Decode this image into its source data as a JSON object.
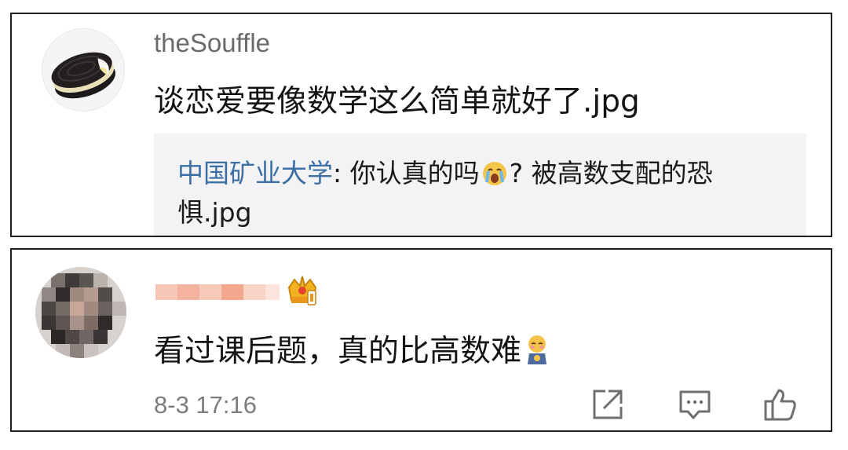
{
  "comment_1": {
    "username": "theSouffle",
    "text": "谈恋爱要像数学这么简单就好了.jpg",
    "reply": {
      "author": "中国矿业大学",
      "separator": ": ",
      "text_before_emoji": "你认真的吗",
      "emoji": "crying-face-emoji",
      "text_after_emoji": "? 被高数支配的恐惧.jpg"
    }
  },
  "comment_2": {
    "username_blurred": true,
    "badge": "crown-icon",
    "text": "看过课后题，真的比高数难",
    "emoji": "shy-person-emoji",
    "timestamp": "8-3 17:16",
    "actions": [
      "share-icon",
      "reply-icon",
      "thumbs-up-icon"
    ]
  }
}
